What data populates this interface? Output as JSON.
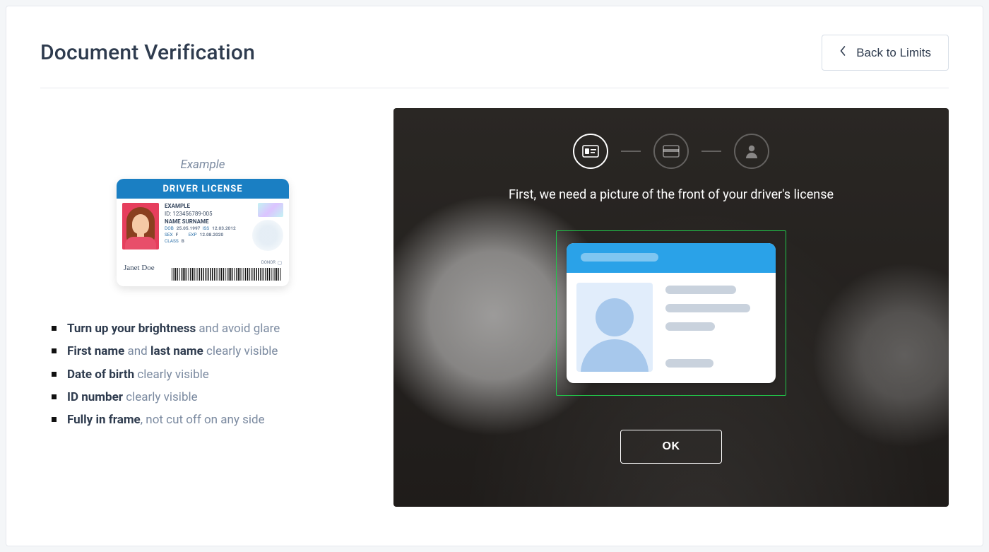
{
  "header": {
    "title": "Document Verification",
    "back_label": "Back to Limits"
  },
  "example": {
    "label": "Example",
    "card_header": "DRIVER LICENSE",
    "line1": "EXAMPLE",
    "line2": "ID: 123456789-005",
    "line3": "NAME SURNAME",
    "dob_label": "DOB",
    "dob_value": "25.05.1997",
    "iss_label": "ISS",
    "iss_value": "12.03.2012",
    "sex_label": "SEX",
    "sex_value": "F",
    "exp_label": "EXP",
    "exp_value": "12.08.2020",
    "class_label": "CLASS",
    "class_value": "B",
    "donor_label": "DONOR",
    "signature": "Janet Doe"
  },
  "tips": [
    {
      "strong_a": "Turn up your brightness",
      "tail": " and avoid glare"
    },
    {
      "strong_a": "First name",
      "mid": " and ",
      "strong_b": "last name",
      "tail": " clearly visible"
    },
    {
      "strong_a": "Date of birth",
      "tail": " clearly visible"
    },
    {
      "strong_a": "ID number",
      "tail": " clearly visible"
    },
    {
      "strong_a": "Fully in frame",
      "tail": ", not cut off on any side"
    }
  ],
  "camera": {
    "instruction": "First, we need a picture of the front of your driver's license",
    "ok_label": "OK"
  }
}
